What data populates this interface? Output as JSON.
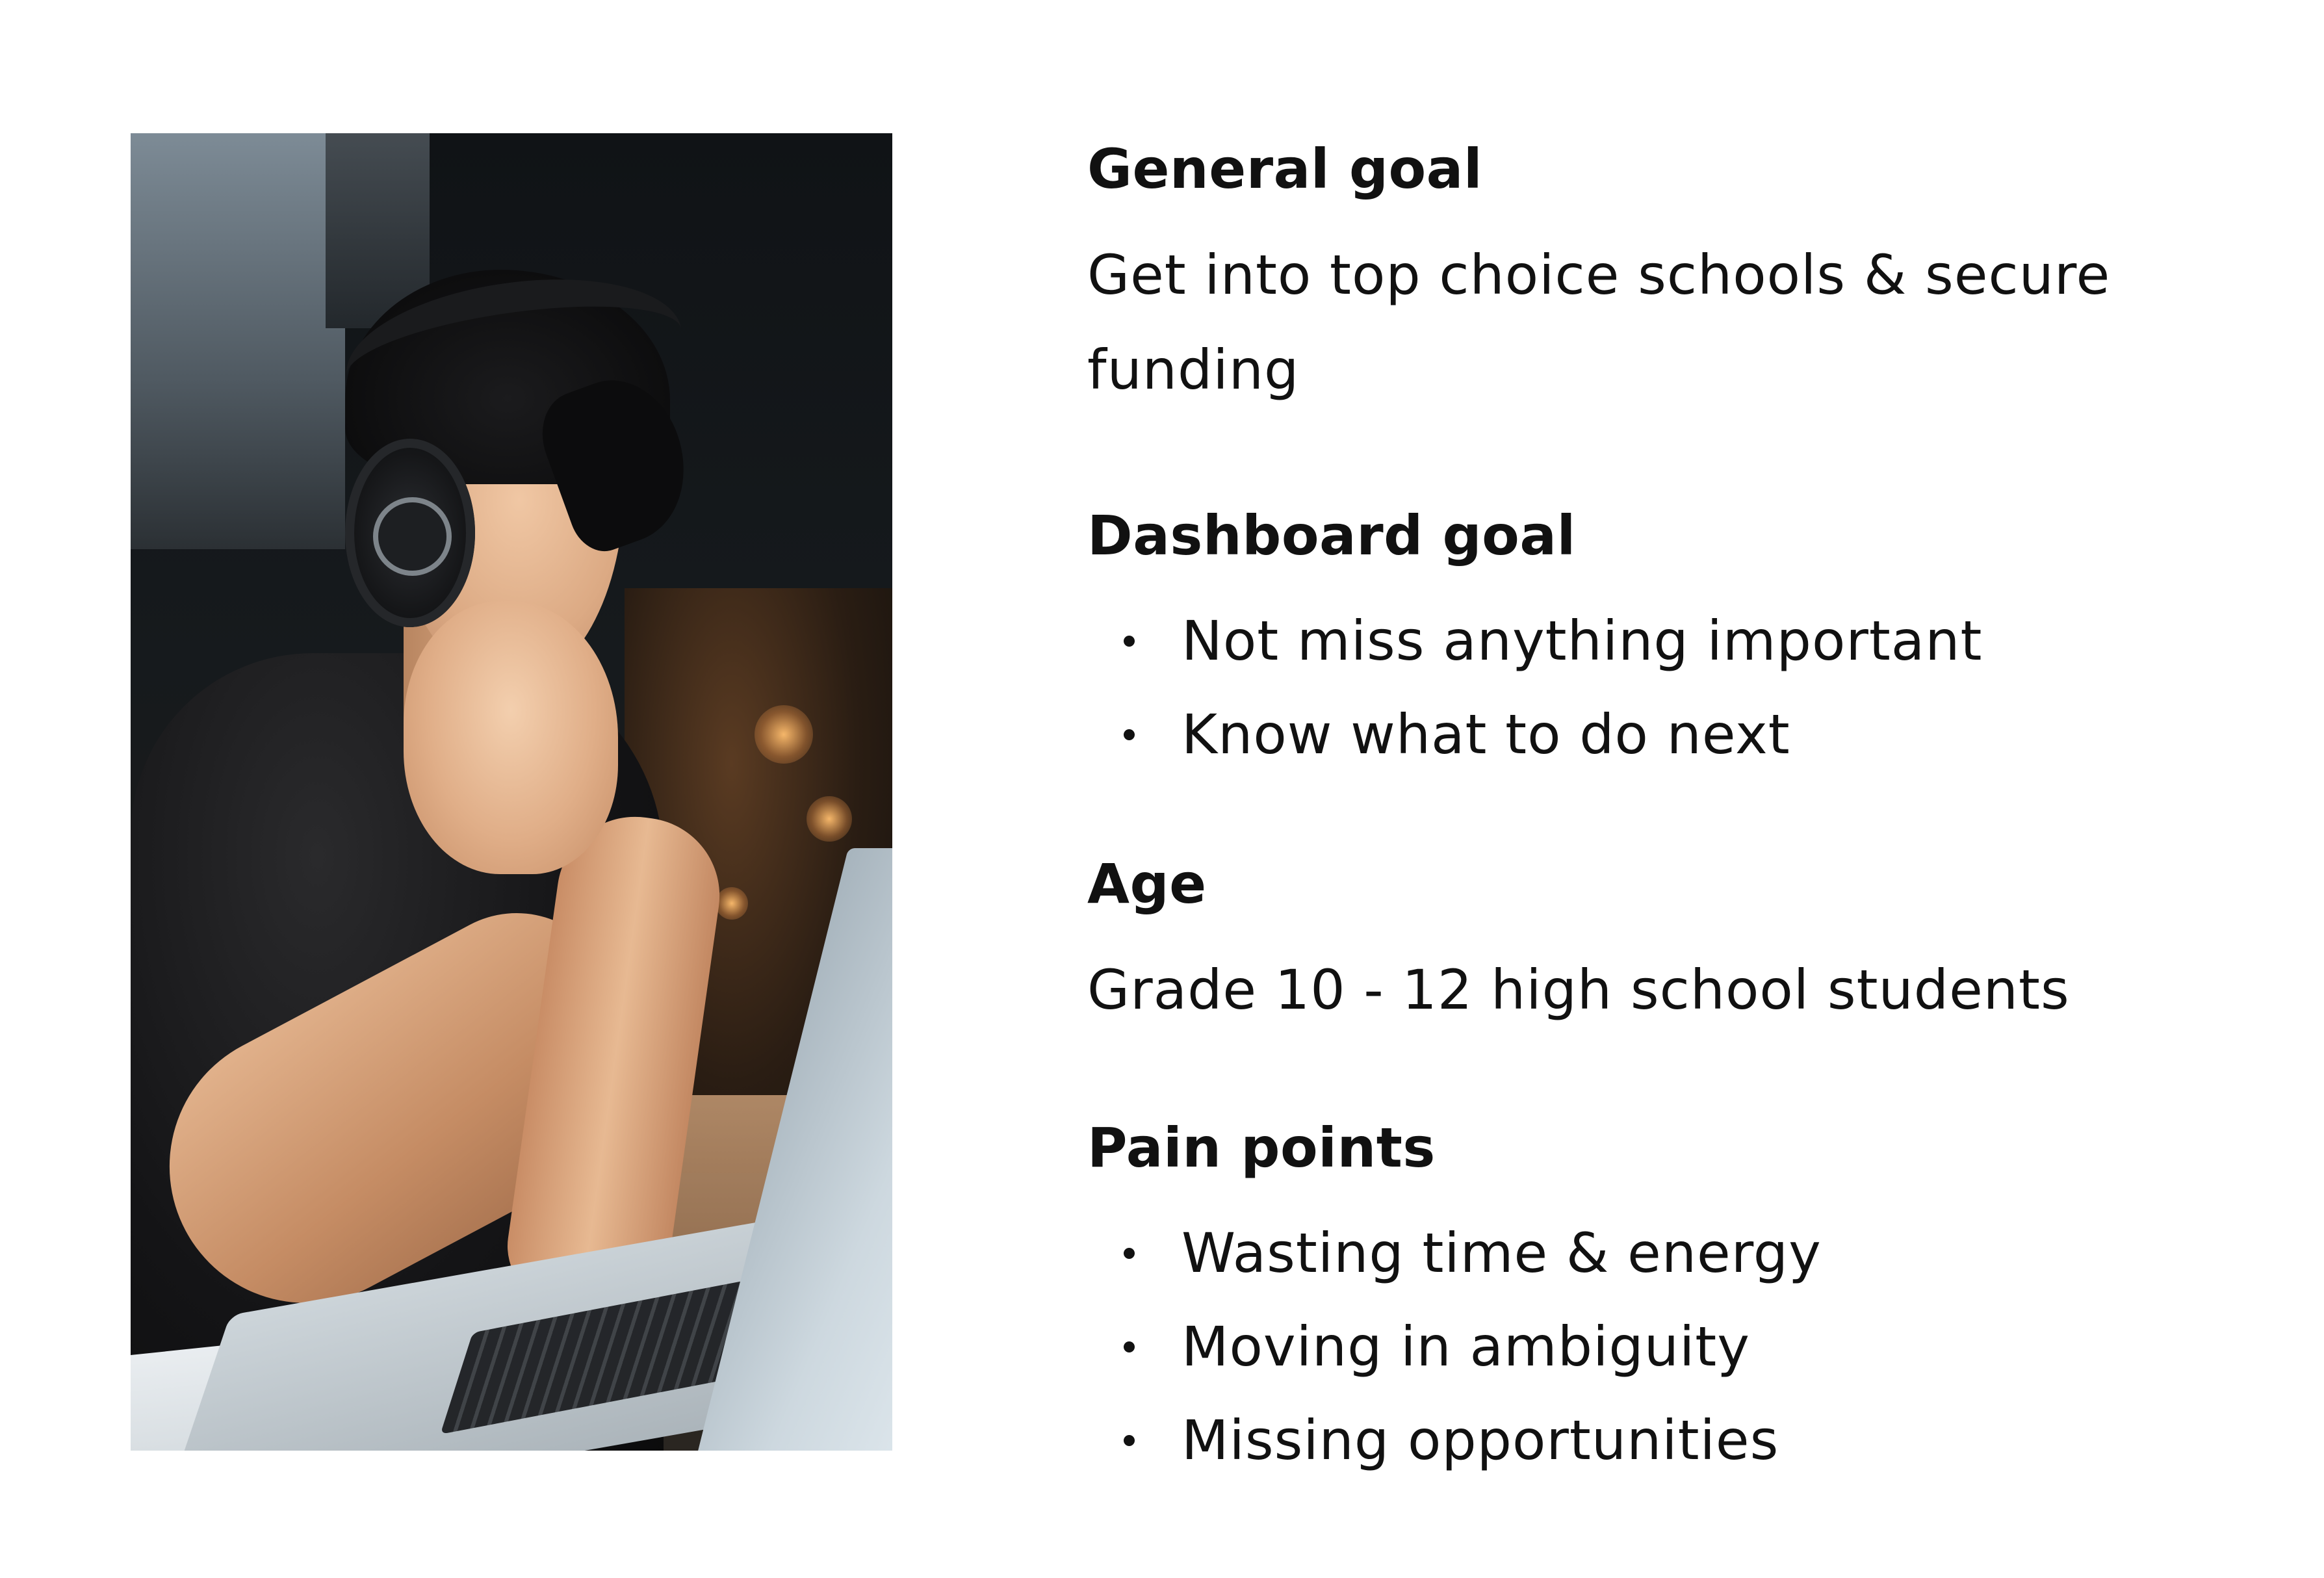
{
  "photo": {
    "subject": "person-with-headphones-at-laptop"
  },
  "sections": [
    {
      "heading": "General goal",
      "text": "Get into top choice schools & secure funding"
    },
    {
      "heading": "Dashboard goal",
      "items": [
        "Not miss anything important",
        "Know what to do next"
      ]
    },
    {
      "heading": "Age",
      "text": "Grade 10 - 12 high school students"
    },
    {
      "heading": "Pain points",
      "items": [
        "Wasting time & energy",
        "Moving in ambiguity",
        "Missing opportunities"
      ]
    }
  ],
  "colors": {
    "background": "#ffffff",
    "text": "#111111"
  }
}
